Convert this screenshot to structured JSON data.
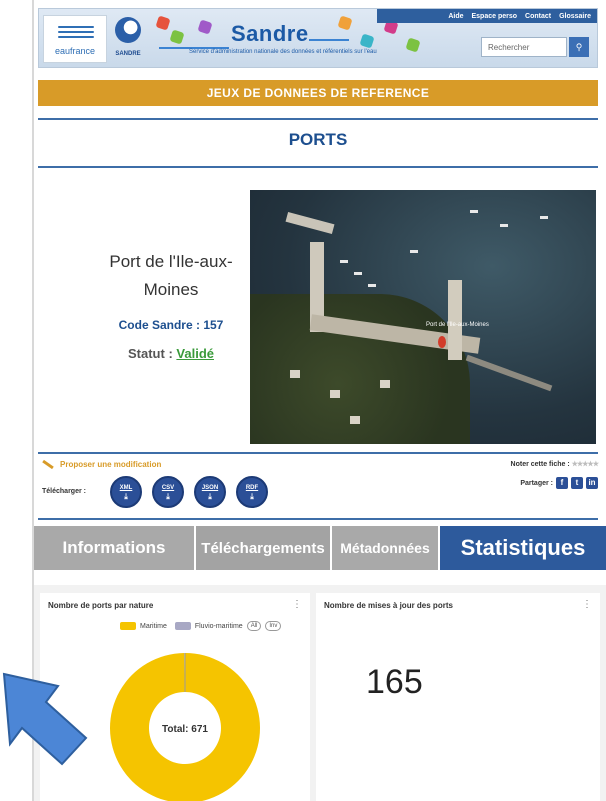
{
  "header": {
    "eau_logo": "eaufrance",
    "sandre_logo": "SANDRE",
    "site_title": "Sandre",
    "site_subtitle": "Service d'administration nationale des données et référentiels sur l'eau",
    "links": [
      "Aide",
      "Espace perso",
      "Contact",
      "Glossaire"
    ],
    "search_placeholder": "Rechercher"
  },
  "section_title": "JEUX DE DONNEES DE REFERENCE",
  "dataset_title": "PORTS",
  "record": {
    "name": "Port de l'Ile-aux-Moines",
    "code_label": "Code Sandre :",
    "code_value": "157",
    "statut_label": "Statut :",
    "statut_value": "Validé",
    "map_caption": "Port de l'Ile-aux-Moines"
  },
  "actions": {
    "propose": "Proposer une modification",
    "telecharger": "Télécharger :",
    "formats": [
      "XML",
      "CSV",
      "JSON",
      "RDF"
    ],
    "noter": "Noter cette fiche :",
    "partager": "Partager :"
  },
  "tabs": {
    "info": "Informations",
    "downloads": "Téléchargements",
    "metadata": "Métadonnées",
    "stats": "Statistiques",
    "active": "Statistiques"
  },
  "stats": {
    "panel1_title": "Nombre de ports par nature",
    "legend_items": [
      "Maritime",
      "Fluvio-maritime"
    ],
    "legend_pills": [
      "All",
      "Inv"
    ],
    "colors": {
      "maritime": "#f5c400",
      "fluvio": "#a8a8c4"
    },
    "total_label": "Total: 671",
    "panel2_title": "Nombre de mises à jour des ports",
    "updates_value": "165"
  },
  "chart_data": {
    "type": "pie",
    "categories": [
      "Maritime",
      "Fluvio-maritime"
    ],
    "values": [
      670,
      1
    ],
    "title": "Nombre de ports par nature"
  }
}
